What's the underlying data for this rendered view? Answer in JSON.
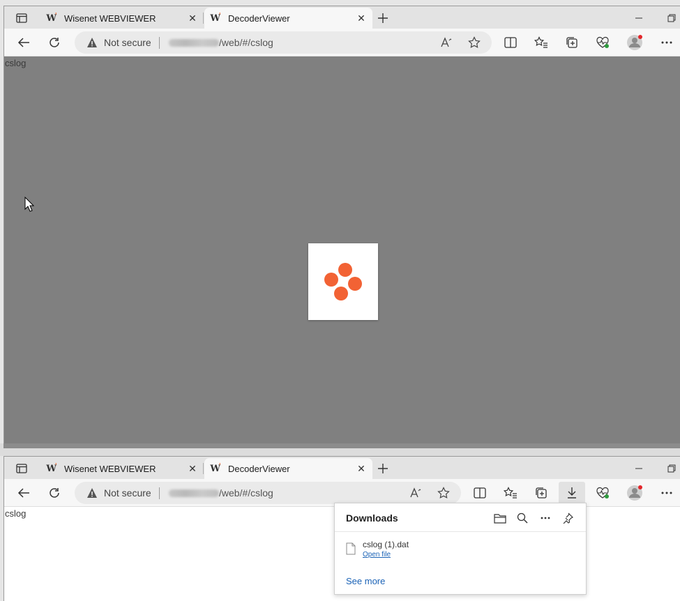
{
  "browser": {
    "tabs": [
      {
        "title": "Wisenet WEBVIEWER",
        "favicon": "W"
      },
      {
        "title": "DecoderViewer",
        "favicon": "W"
      }
    ],
    "security_label": "Not secure",
    "url_visible": "/web/#/cslog",
    "url_host": "192.168.x.x"
  },
  "page": {
    "text": "cslog",
    "loader_color": "#f26234"
  },
  "downloads": {
    "title": "Downloads",
    "file_name": "cslog (1).dat",
    "open_file": "Open file",
    "see_more": "See more"
  },
  "colors": {
    "content_overlay": "#808080",
    "link": "#1a62b6",
    "accent": "#f26234"
  }
}
